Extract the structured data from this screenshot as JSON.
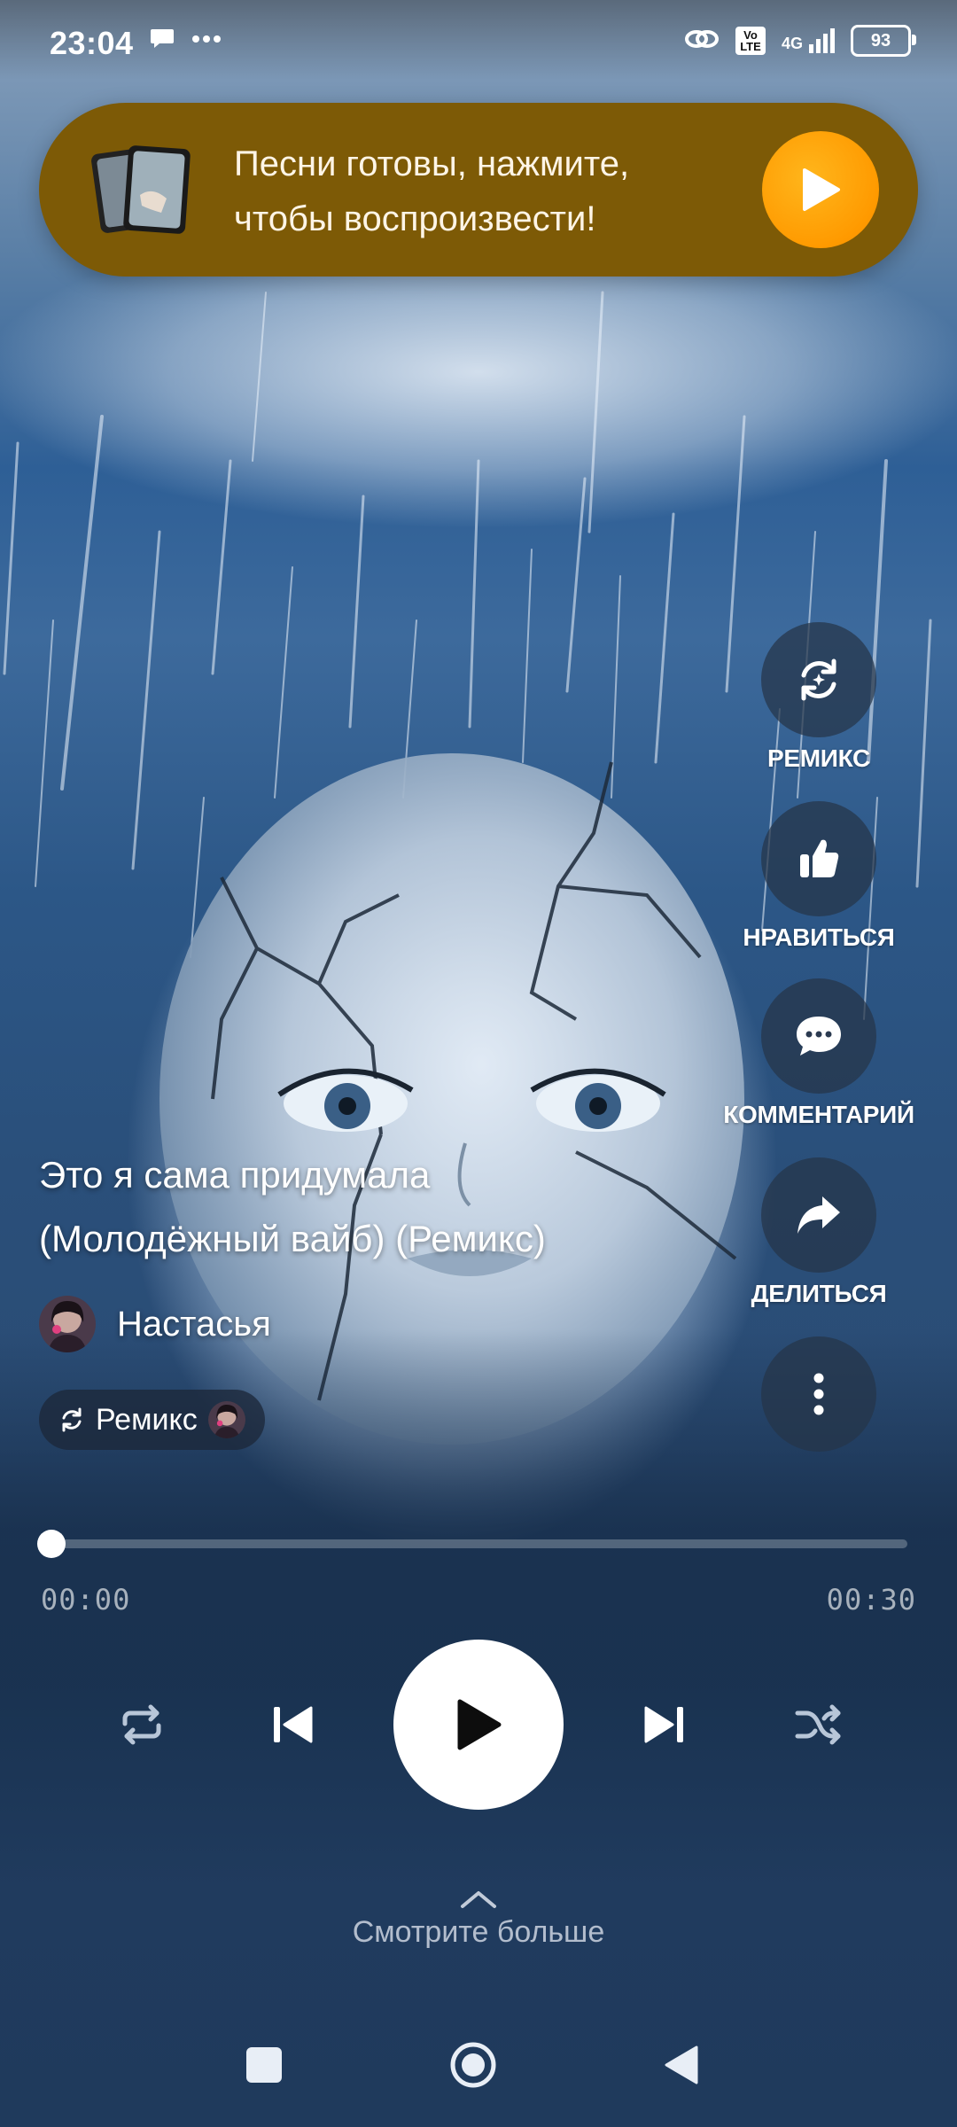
{
  "status_bar": {
    "time": "23:04",
    "left_icons": [
      "chat-bubble-icon",
      "more-dots-icon"
    ],
    "right_icons": [
      "link-icon",
      "volte-icon",
      "4g-signal-icon"
    ],
    "volte_text": "Vo LTE",
    "network": "4G",
    "battery": "93"
  },
  "banner": {
    "text": "Песни готовы, нажмите, чтобы воспроизвести!",
    "play_icon": "play-icon",
    "accent": "#ff9d00"
  },
  "actions": {
    "remix": "РЕМИКС",
    "like": "НРАВИТЬСЯ",
    "comment": "КОММЕНТАРИЙ",
    "share": "ДЕЛИТЬСЯ"
  },
  "song": {
    "title_line1": "Это я сама придумала",
    "title_line2": "(Молодёжный вайб) (Ремикс)",
    "artist": "Настасья",
    "remix_chip": "Ремикс"
  },
  "player": {
    "current_time": "00:00",
    "total_time": "00:30",
    "progress": 0.0
  },
  "footer": {
    "see_more": "Смотрите больше"
  },
  "nav": [
    "recent-apps-icon",
    "home-icon",
    "back-icon"
  ]
}
